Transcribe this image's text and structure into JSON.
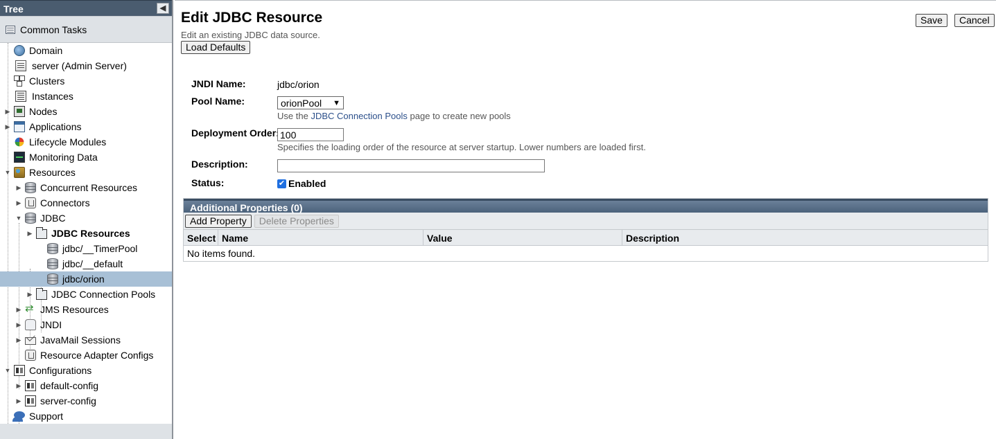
{
  "sidebar": {
    "title": "Tree",
    "collapse_glyph": "◀",
    "common_tasks": "Common Tasks",
    "items": [
      {
        "label": "Domain",
        "icon": "globe-icon"
      },
      {
        "label": "server (Admin Server)",
        "icon": "server-icon"
      },
      {
        "label": "Clusters",
        "icon": "clusters-icon"
      },
      {
        "label": "Instances",
        "icon": "instances-icon"
      },
      {
        "label": "Nodes",
        "icon": "nodes-icon"
      },
      {
        "label": "Applications",
        "icon": "applications-icon"
      },
      {
        "label": "Lifecycle Modules",
        "icon": "lifecycle-icon"
      },
      {
        "label": "Monitoring Data",
        "icon": "monitor-icon"
      },
      {
        "label": "Resources",
        "icon": "resources-icon"
      },
      {
        "label": "Concurrent Resources",
        "icon": "database-icon"
      },
      {
        "label": "Connectors",
        "icon": "connector-icon"
      },
      {
        "label": "JDBC",
        "icon": "database-icon"
      },
      {
        "label": "JDBC Resources",
        "icon": "folder-icon"
      },
      {
        "label": "jdbc/__TimerPool",
        "icon": "database-icon"
      },
      {
        "label": "jdbc/__default",
        "icon": "database-icon"
      },
      {
        "label": "jdbc/orion",
        "icon": "database-icon"
      },
      {
        "label": "JDBC Connection Pools",
        "icon": "folder-icon"
      },
      {
        "label": "JMS Resources",
        "icon": "jms-icon"
      },
      {
        "label": "JNDI",
        "icon": "jndi-icon"
      },
      {
        "label": "JavaMail Sessions",
        "icon": "mail-icon"
      },
      {
        "label": "Resource Adapter Configs",
        "icon": "connector-icon"
      },
      {
        "label": "Configurations",
        "icon": "config-icon"
      },
      {
        "label": "default-config",
        "icon": "config-icon"
      },
      {
        "label": "server-config",
        "icon": "config-icon"
      },
      {
        "label": "Support",
        "icon": "support-icon"
      }
    ]
  },
  "main": {
    "title": "Edit JDBC Resource",
    "help": "Edit an existing JDBC data source.",
    "load_defaults": "Load Defaults",
    "save": "Save",
    "cancel": "Cancel",
    "form": {
      "jndi_label": "JNDI Name:",
      "jndi_value": "jdbc/orion",
      "pool_label": "Pool Name:",
      "pool_value": "orionPool",
      "pool_help_prefix": "Use the",
      "pool_help_link": "JDBC Connection Pools",
      "pool_help_suffix": "page to create new pools",
      "order_label": "Deployment Order:",
      "order_value": "100",
      "order_help": "Specifies the loading order of the resource at server startup. Lower numbers are loaded first.",
      "desc_label": "Description:",
      "desc_value": "",
      "status_label": "Status:",
      "status_enabled_label": "Enabled",
      "status_enabled": true
    },
    "properties": {
      "title": "Additional Properties (0)",
      "add": "Add Property",
      "delete": "Delete Properties",
      "columns": [
        "Select",
        "Name",
        "Value",
        "Description"
      ],
      "empty": "No items found."
    }
  }
}
